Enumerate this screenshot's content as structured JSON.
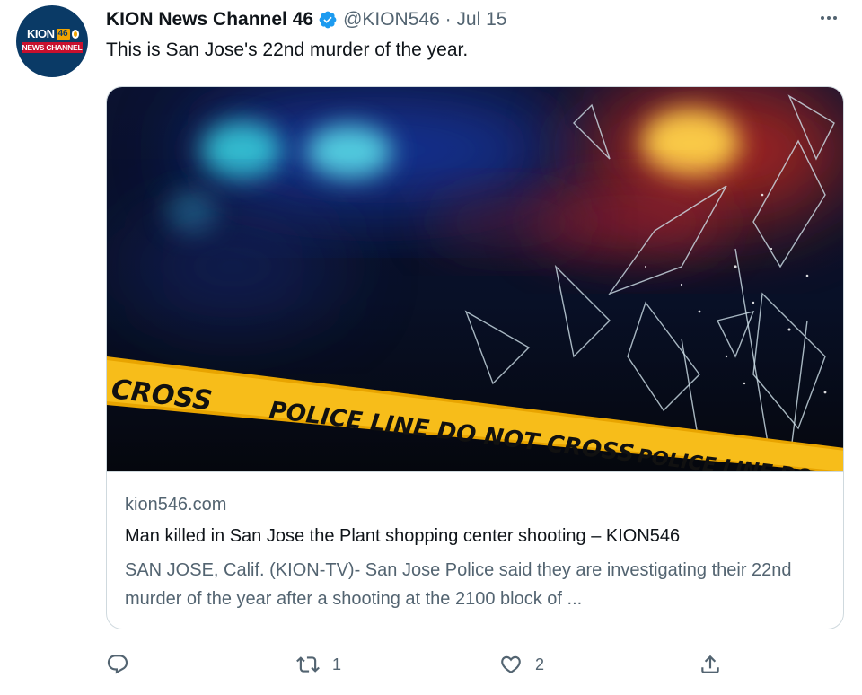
{
  "tweet": {
    "author_name": "KION News Channel 46",
    "handle_and_date": "@KION546 · Jul 15",
    "text": "This is San Jose's 22nd murder of the year.",
    "avatar": {
      "logo_word": "KION",
      "logo_number": "46",
      "logo_band": "NEWS CHANNEL"
    },
    "verified_icon": "verified-badge-icon",
    "more_icon": "more-options-icon"
  },
  "card": {
    "image_text": {
      "tape_left": "CROSS",
      "tape_middle": "POLICE LINE DO NOT CROSS",
      "tape_right": "POLICE LINE DO NOT CROSS"
    },
    "domain": "kion546.com",
    "title": "Man killed in San Jose the Plant shopping center shooting – KION546",
    "description": "SAN JOSE, Calif. (KION-TV)- San Jose Police said they are investigating their 22nd murder of the year after a shooting at the 2100 block of ..."
  },
  "actions": {
    "reply": {
      "icon": "reply-icon",
      "count": ""
    },
    "retweet": {
      "icon": "retweet-icon",
      "count": "1"
    },
    "like": {
      "icon": "like-icon",
      "count": "2"
    },
    "share": {
      "icon": "share-icon"
    }
  },
  "colors": {
    "verified": "#1d9bf0",
    "secondary_text": "#536471",
    "primary_text": "#0f1419",
    "tape_yellow": "#f5b400",
    "avatar_navy": "#0a3a66"
  }
}
